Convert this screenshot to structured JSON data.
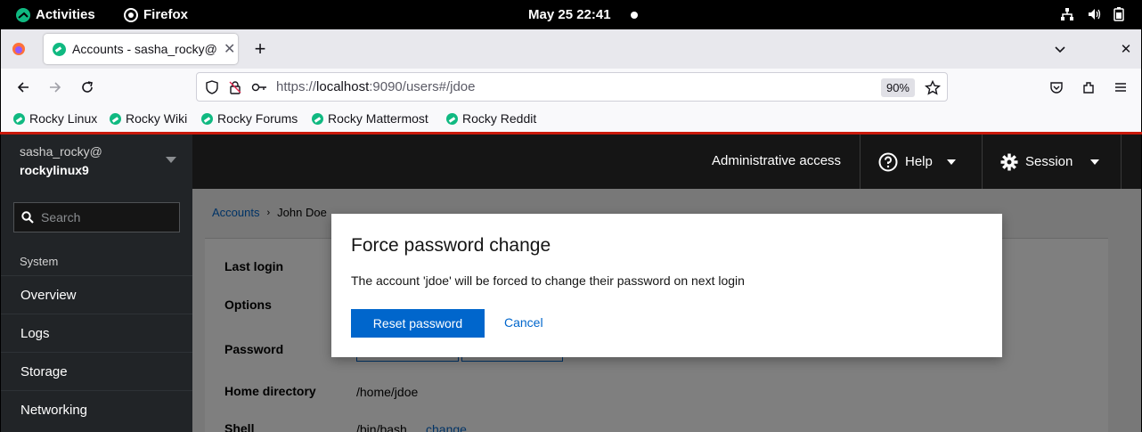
{
  "gnome": {
    "activities": "Activities",
    "app": "Firefox",
    "datetime": "May 25  22:41"
  },
  "browser": {
    "tab_title": "Accounts - sasha_rocky@",
    "url_scheme": "https://",
    "url_host": "localhost",
    "url_rest": ":9090/users#/jdoe",
    "zoom": "90%",
    "bookmarks": [
      "Rocky Linux",
      "Rocky Wiki",
      "Rocky Forums",
      "Rocky Mattermost",
      "Rocky Reddit"
    ]
  },
  "cockpit": {
    "user": "sasha_rocky@",
    "host": "rockylinux9",
    "search_placeholder": "Search",
    "section": "System",
    "nav": [
      "Overview",
      "Logs",
      "Storage",
      "Networking"
    ],
    "admin_access": "Administrative access",
    "help": "Help",
    "session": "Session",
    "breadcrumb_root": "Accounts",
    "breadcrumb_current": "John Doe",
    "fields": {
      "last_login": "Last login",
      "options": "Options",
      "password": "Password",
      "home_directory": "Home directory",
      "home_value": "/home/jdoe",
      "shell": "Shell",
      "shell_value": "/bin/bash",
      "shell_change": "change"
    }
  },
  "modal": {
    "title": "Force password change",
    "body": "The account 'jdoe' will be forced to change their password on next login",
    "confirm": "Reset password",
    "cancel": "Cancel"
  },
  "colors": {
    "accent_blue": "#0066cc",
    "brand_red": "#c9190b",
    "rocky_green": "#10b981"
  }
}
